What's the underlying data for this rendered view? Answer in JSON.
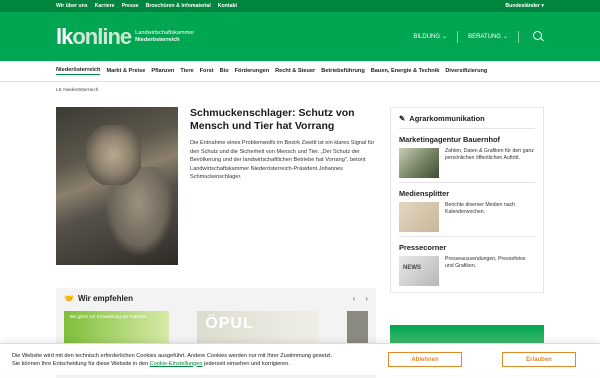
{
  "topbar": {
    "links": [
      "Wir über uns",
      "Karriere",
      "Presse",
      "Broschüren & Infomaterial",
      "Kontakt"
    ],
    "region": "Bundesländer ▾"
  },
  "header": {
    "logo_lk": "lk",
    "logo_online": "online",
    "logo_line1": "Landwirtschaftskammer",
    "logo_line2": "Niederösterreich",
    "nav": [
      "BILDUNG",
      "BERATUNG"
    ]
  },
  "subnav": [
    "Niederösterreich",
    "Markt & Preise",
    "Pflanzen",
    "Tiere",
    "Forst",
    "Bio",
    "Förderungen",
    "Recht & Steuer",
    "Betriebsführung",
    "Bauen, Energie & Technik",
    "Diversifizierung"
  ],
  "breadcrumb": "LK Niederösterreich",
  "feature": {
    "title": "Schmuckenschlager: Schutz von Mensch und Tier hat Vorrang",
    "text": "Die Entnahme eines Problemwolfs im Bezirk Zwettl ist ein klares Signal für den Schutz und die Sicherheit von Mensch und Tier. „Der Schutz der Bevölkerung und der landwirtschaftlichen Betriebe hat Vorrang\", betont Landwirtschaftskammer Niederösterreich-Präsident Johannes Schmuckenschlager."
  },
  "recommend": {
    "title": "Wir empfehlen",
    "tile1": "Bei gibt's zur Entwicklung der Kulturen",
    "tile2": "ÖPUL"
  },
  "sidebar": {
    "title": "Agrarkommunikation",
    "sections": [
      {
        "title": "Marketingagentur Bauernhof",
        "text": "Zahlen, Daten & Grafiken für den ganz persönlichen öffentlichen Auftritt."
      },
      {
        "title": "Mediensplitter",
        "text": "Berichte diverser Medien nach Kalenderwochen."
      },
      {
        "title": "Pressecorner",
        "text": "Presseaussendungen, Pressefotos und Grafiken.",
        "thumb_text": "NEWS"
      }
    ]
  },
  "cookie": {
    "line1": "Die Website wird mit den technisch erforderlichen Cookies ausgeführt. Andere Cookies werden nur mit Ihrer Zustimmung gesetzt.",
    "line2_pre": "Sie können Ihre Entscheidung für diese Website in den ",
    "line2_link": "Cookie-Einstellungen",
    "line2_post": " jederzeit einsehen und korrigieren.",
    "decline": "Ablehnen",
    "accept": "Erlauben"
  },
  "colors": {
    "brand_green": "#00a651",
    "dark_green": "#00853f",
    "cookie_orange": "#e08a2c"
  }
}
